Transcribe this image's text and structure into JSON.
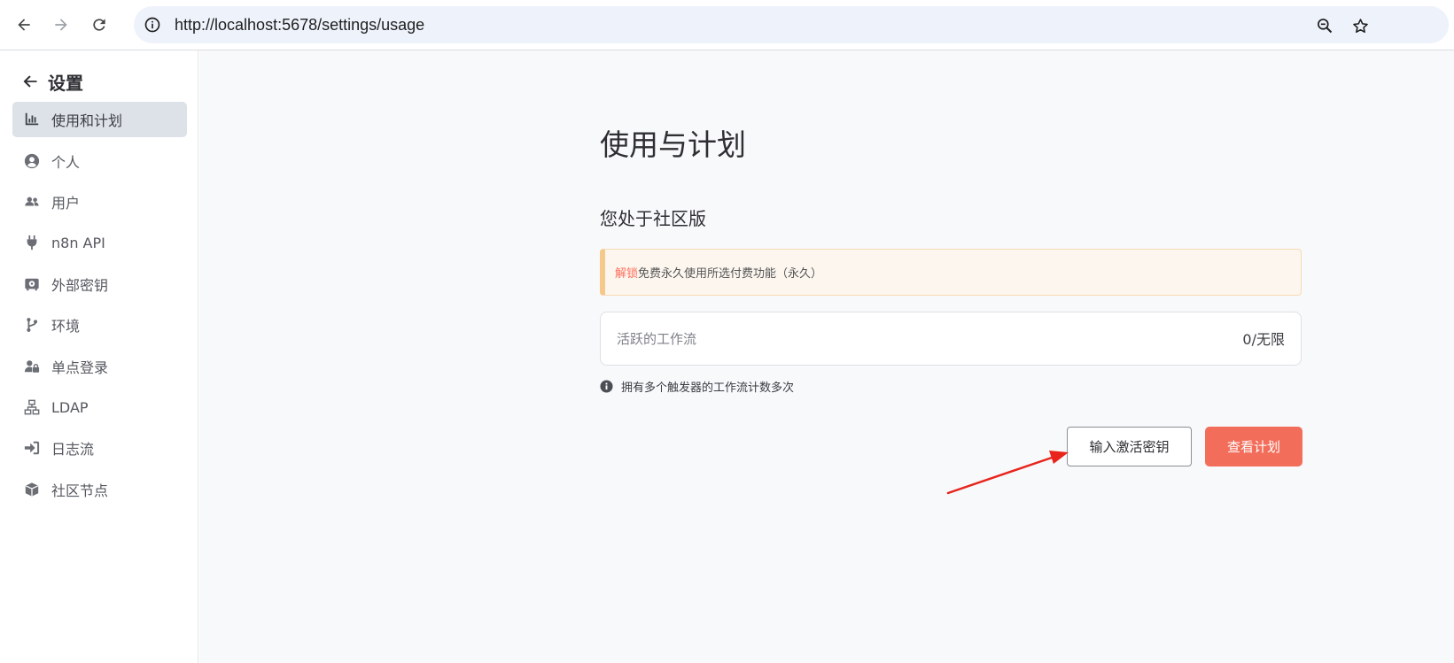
{
  "browser": {
    "url": "http://localhost:5678/settings/usage",
    "icons": [
      "back-arrow-icon",
      "forward-arrow-icon",
      "reload-icon",
      "site-info-icon",
      "zoom-icon",
      "bookmark-star-icon"
    ]
  },
  "sidebar": {
    "back_label": "设置",
    "items": [
      {
        "label": "使用和计划",
        "icon": "bar-chart-icon",
        "active": true
      },
      {
        "label": "个人",
        "icon": "user-circle-icon",
        "active": false
      },
      {
        "label": "用户",
        "icon": "users-icon",
        "active": false
      },
      {
        "label": "n8n API",
        "icon": "plug-icon",
        "active": false
      },
      {
        "label": "外部密钥",
        "icon": "vault-icon",
        "active": false
      },
      {
        "label": "环境",
        "icon": "code-branch-icon",
        "active": false
      },
      {
        "label": "单点登录",
        "icon": "user-lock-icon",
        "active": false
      },
      {
        "label": "LDAP",
        "icon": "network-icon",
        "active": false
      },
      {
        "label": "日志流",
        "icon": "sign-in-icon",
        "active": false
      },
      {
        "label": "社区节点",
        "icon": "cube-icon",
        "active": false
      }
    ]
  },
  "main": {
    "title": "使用与计划",
    "subtitle": "您处于社区版",
    "banner": {
      "link": "解锁",
      "text": "免费永久使用所选付费功能（永久）"
    },
    "usage": {
      "label": "活跃的工作流",
      "value": "0/无限"
    },
    "hint": "拥有多个触发器的工作流计数多次",
    "buttons": {
      "activation_key": "输入激活密钥",
      "view_plans": "查看计划"
    }
  },
  "colors": {
    "accent": "#f26e5b",
    "banner_bg": "#fcf6ef",
    "banner_border": "#f5c88c",
    "sidebar_active": "#dde1e8",
    "annotation_arrow": "#e8241c"
  }
}
